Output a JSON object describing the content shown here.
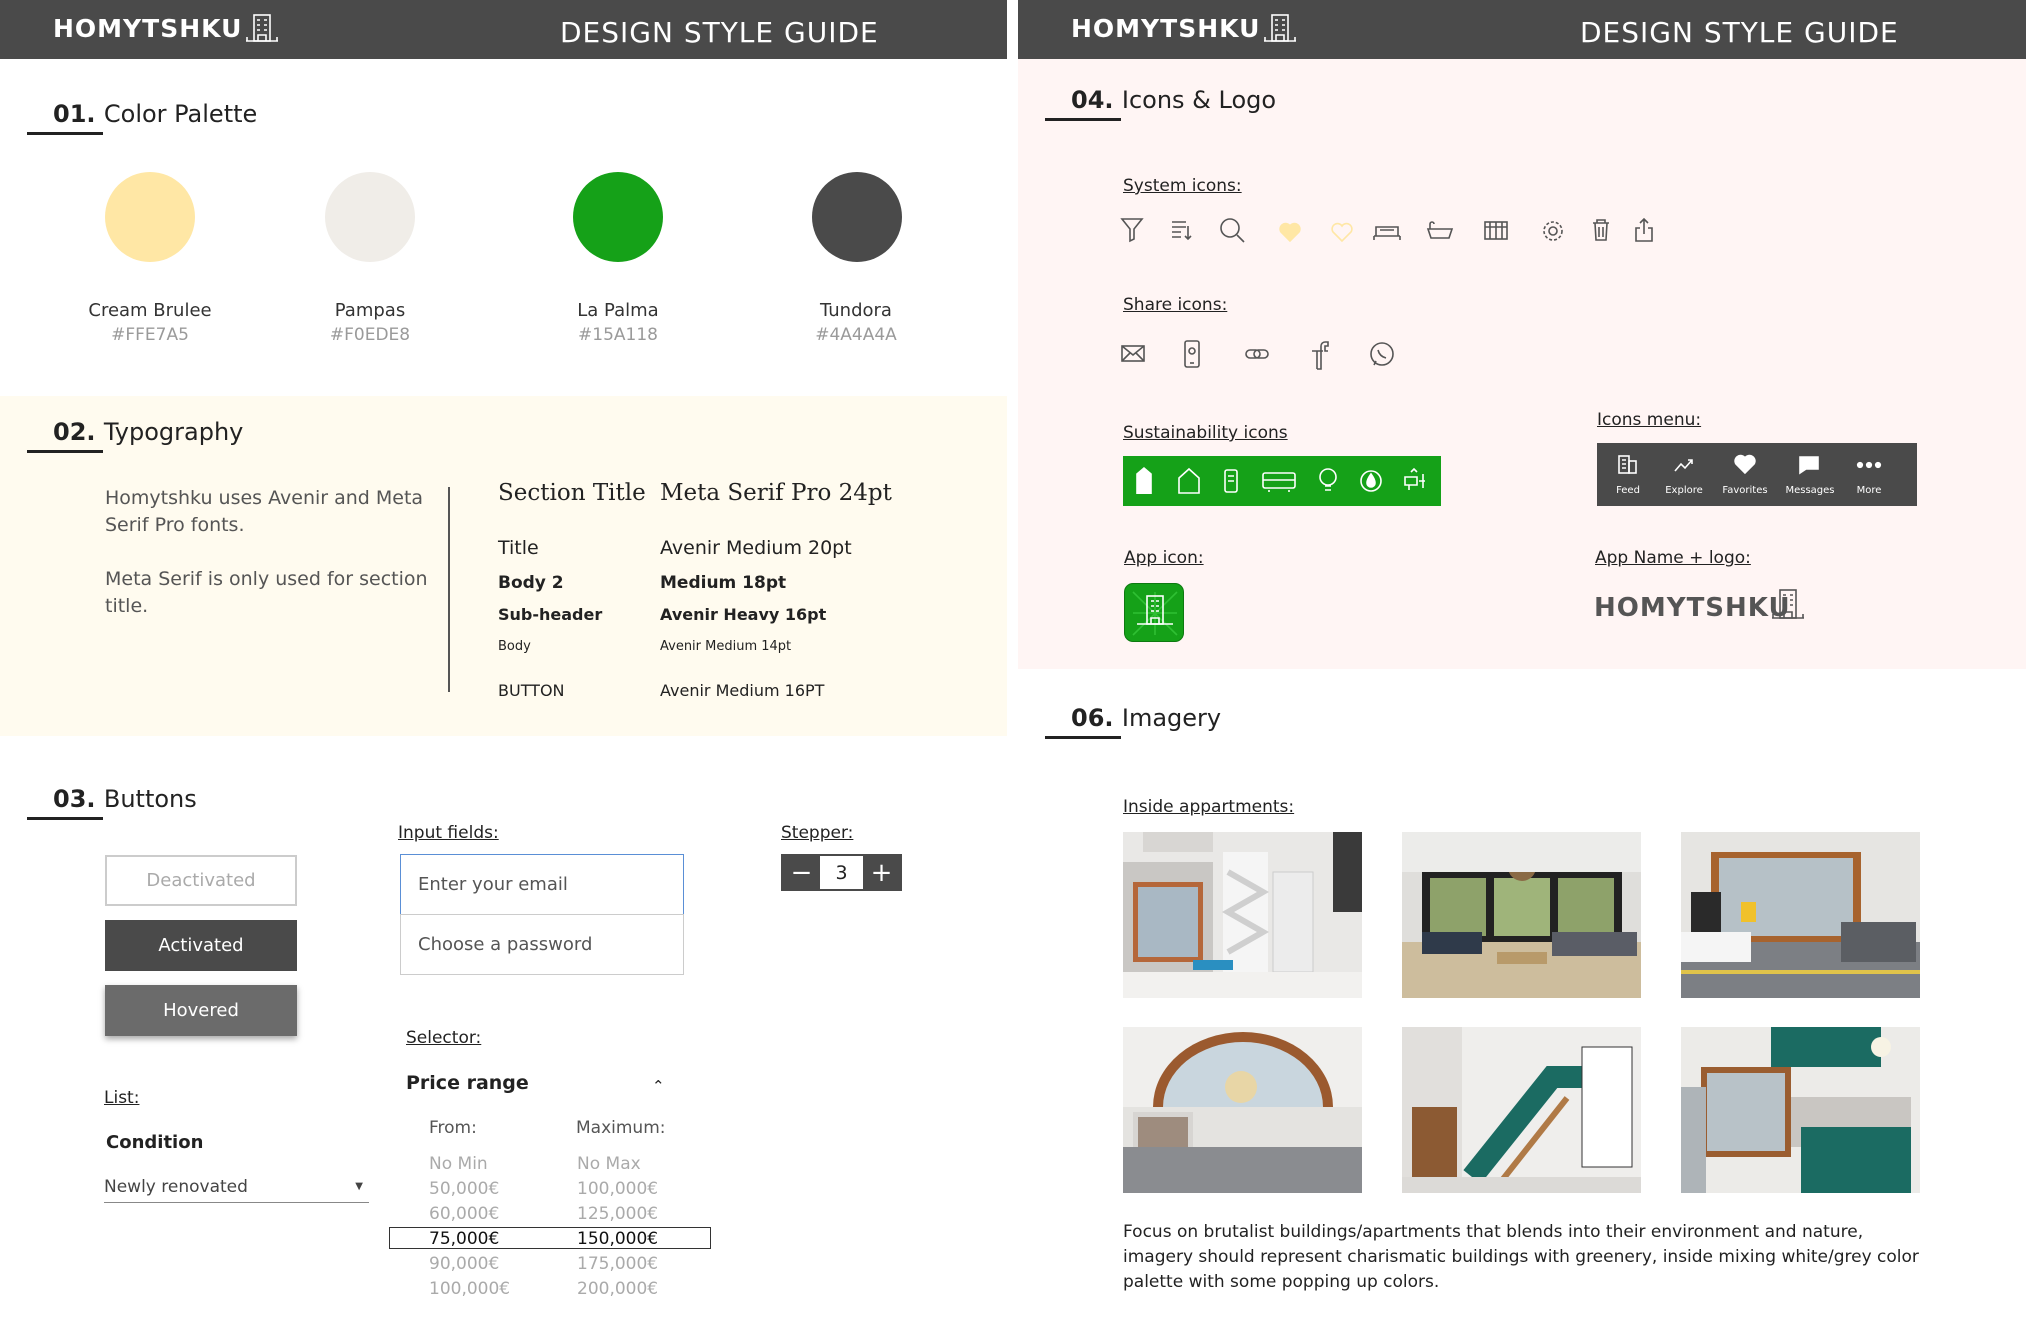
{
  "header": {
    "brand": "HOMYTSHKU",
    "title": "DESIGN STYLE GUIDE"
  },
  "colors": {
    "header_bg": "#4A4A4A",
    "typography_bg": "#FFFBEF",
    "icons_bg": "#FFF5F4",
    "accent_green": "#15A118"
  },
  "palette": {
    "title_num": "01.",
    "title_text": "Color Palette",
    "swatches": [
      {
        "name": "Cream Brulee",
        "hex": "#FFE7A5"
      },
      {
        "name": "Pampas",
        "hex": "#F0EDE8"
      },
      {
        "name": "La Palma",
        "hex": "#15A118"
      },
      {
        "name": "Tundora",
        "hex": "#4A4A4A"
      }
    ]
  },
  "typography": {
    "title_num": "02.",
    "title_text": "Typography",
    "intro_1": "Homytshku uses Avenir and Meta Serif Pro fonts.",
    "intro_2": "Meta Serif is only used for section title.",
    "rows": [
      {
        "label": "Section Title",
        "spec": "Meta Serif Pro 24pt"
      },
      {
        "label": "Title",
        "spec": "Avenir Medium 20pt"
      },
      {
        "label": "Body 2",
        "spec": "Medium 18pt"
      },
      {
        "label": "Sub-header",
        "spec": "Avenir Heavy 16pt"
      },
      {
        "label": "Body",
        "spec": "Avenir Medium 14pt"
      },
      {
        "label": "BUTTON",
        "spec": "Avenir Medium 16PT"
      }
    ]
  },
  "buttons": {
    "title_num": "03.",
    "title_text": "Buttons",
    "deactivated": "Deactivated",
    "activated": "Activated",
    "hovered": "Hovered",
    "input_label": "Input fields:",
    "email_placeholder": "Enter your email",
    "password_placeholder": "Choose a password",
    "stepper_label": "Stepper:",
    "stepper_value": "3",
    "selector_label": "Selector:",
    "selector_title": "Price range",
    "from_label": "From:",
    "max_label": "Maximum:",
    "from_options": [
      "No Min",
      "50,000€",
      "60,000€",
      "75,000€",
      "90,000€",
      "100,000€"
    ],
    "max_options": [
      "No Max",
      "100,000€",
      "125,000€",
      "150,000€",
      "175,000€",
      "200,000€"
    ],
    "selected_index": 3,
    "list_label": "List:",
    "list_title": "Condition",
    "list_value": "Newly renovated"
  },
  "icons": {
    "title_num": "04.",
    "title_text": "Icons & Logo",
    "system_label": "System icons:",
    "share_label": "Share icons:",
    "sustain_label": "Sustainability icons",
    "menu_label": "Icons menu:",
    "menu_items": [
      "Feed",
      "Explore",
      "Favorites",
      "Messages",
      "More"
    ],
    "app_icon_label": "App icon:",
    "app_name_label": "App Name + logo:",
    "app_name": "HOMYTSHKU"
  },
  "imagery": {
    "title_num": "06.",
    "title_text": "Imagery",
    "inside_label": "Inside appartments:",
    "caption": "Focus on brutalist buildings/apartments that blends into their environment and nature, imagery should represent charismatic buildings with greenery, inside mixing white/grey color palette with some popping up colors."
  }
}
